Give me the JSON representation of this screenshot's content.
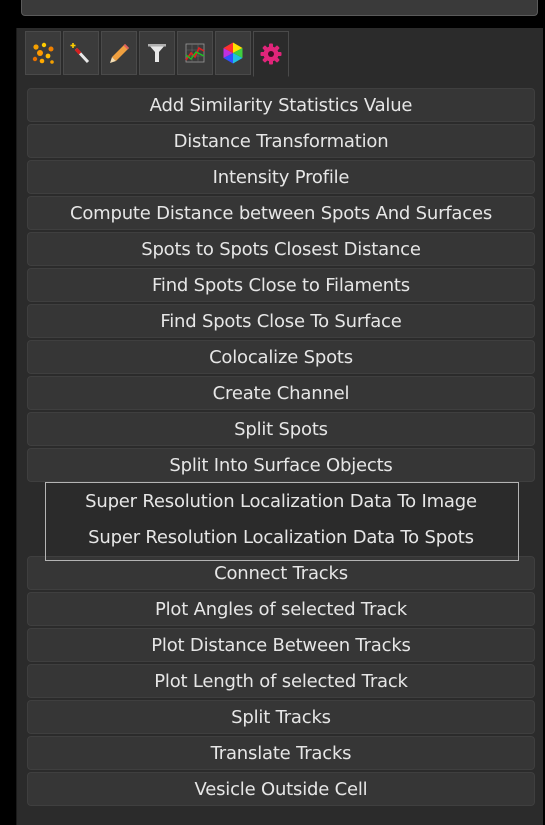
{
  "tabs": [
    {
      "icon": "spots-icon",
      "active": false
    },
    {
      "icon": "magic-wand-icon",
      "active": false
    },
    {
      "icon": "pencil-icon",
      "active": false
    },
    {
      "icon": "filter-icon",
      "active": false
    },
    {
      "icon": "statistics-chart-icon",
      "active": false
    },
    {
      "icon": "color-hexagon-icon",
      "active": false
    },
    {
      "icon": "gear-icon",
      "active": true
    }
  ],
  "items": [
    {
      "label": "Add Similarity Statistics Value"
    },
    {
      "label": "Distance Transformation"
    },
    {
      "label": "Intensity Profile"
    },
    {
      "label": "Compute Distance between Spots And Surfaces"
    },
    {
      "label": "Spots to Spots Closest Distance"
    },
    {
      "label": "Find Spots Close to Filaments"
    },
    {
      "label": "Find Spots Close To Surface"
    },
    {
      "label": "Colocalize Spots"
    },
    {
      "label": "Create Channel"
    },
    {
      "label": "Split Spots"
    },
    {
      "label": "Split Into Surface Objects"
    },
    {
      "label": "Super Resolution Localization Data To Image"
    },
    {
      "label": "Super Resolution Localization Data To Spots"
    },
    {
      "label": "Connect Tracks"
    },
    {
      "label": "Plot Angles of selected Track"
    },
    {
      "label": "Plot Distance Between Tracks"
    },
    {
      "label": "Plot Length of selected Track"
    },
    {
      "label": "Split Tracks"
    },
    {
      "label": "Translate Tracks"
    },
    {
      "label": "Vesicle Outside Cell"
    }
  ],
  "colors": {
    "background": "#000000",
    "panel": "#2b2b2b",
    "button": "#363636",
    "text": "#e6e6e6",
    "gear_accent": "#e0257a",
    "highlight_border": "#b4b4b4"
  }
}
